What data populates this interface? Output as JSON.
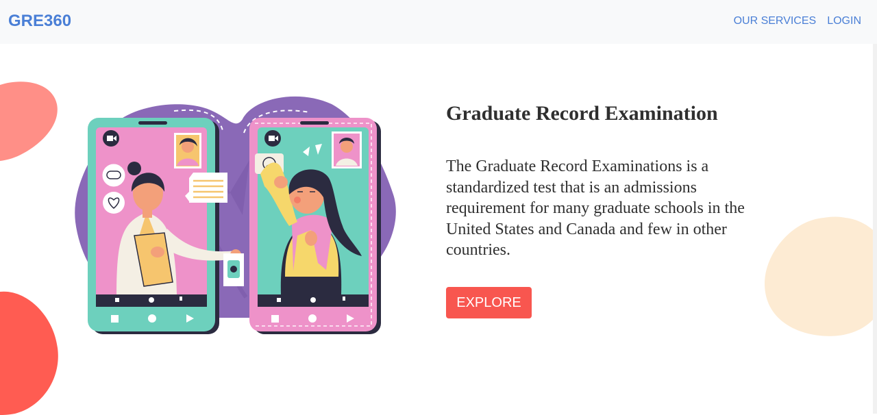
{
  "brand": {
    "name": "GRE360",
    "color": "#4a7fd6"
  },
  "nav": {
    "links": [
      {
        "label": "OUR SERVICES"
      },
      {
        "label": "LOGIN"
      }
    ]
  },
  "hero": {
    "title": "Graduate Record Examination",
    "description": "The Graduate Record Examinations is a standardized test that is an admissions requirement for many graduate schools in the United States and Canada and few in other countries.",
    "cta_label": "EXPLORE",
    "cta_color": "#f8564f",
    "illustration": "telemedicine-video-call-illustration"
  },
  "colors": {
    "nav_background": "#f8f9fa",
    "blob_salmon": "#ff8f87",
    "blob_red": "#ff5c52",
    "blob_peach": "#fdebd3",
    "phone_teal": "#6dd0bd",
    "phone_pink": "#ee92c9",
    "backdrop_purple": "#8a69b7"
  }
}
